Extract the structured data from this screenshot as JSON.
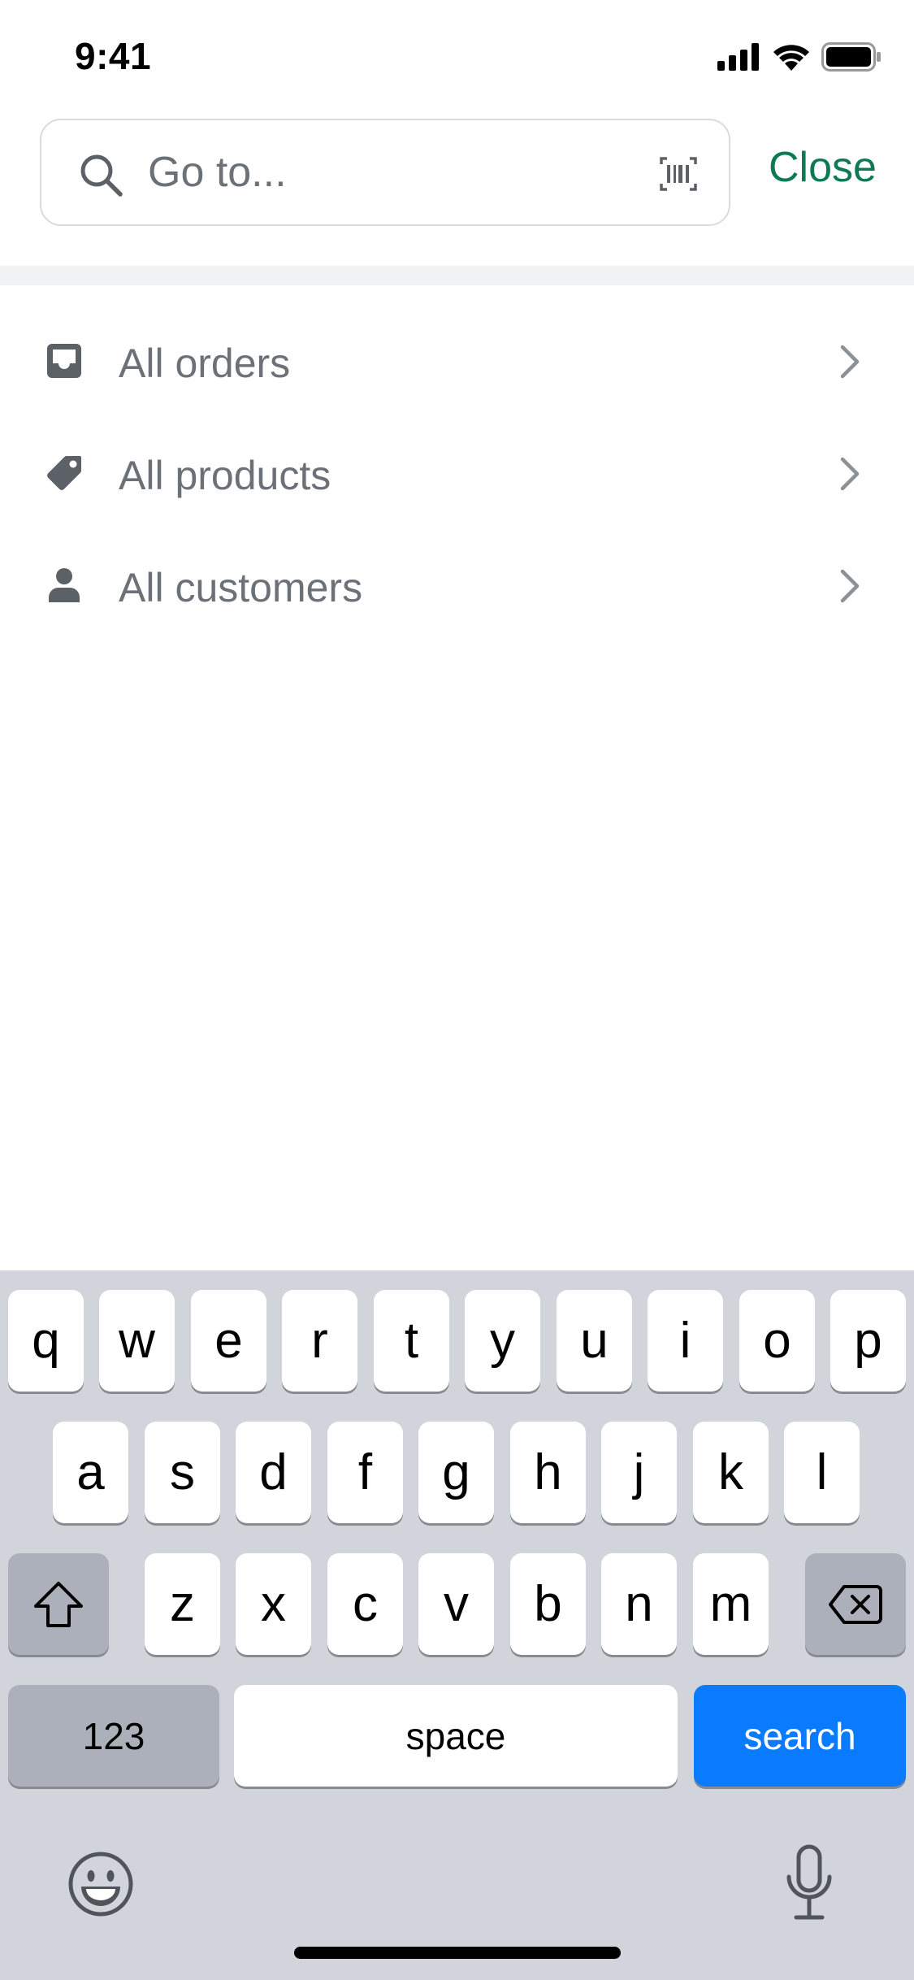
{
  "status_bar": {
    "time": "9:41"
  },
  "search": {
    "placeholder": "Go to...",
    "value": "",
    "close_label": "Close"
  },
  "nav": {
    "items": [
      {
        "label": "All orders",
        "icon": "inbox-icon"
      },
      {
        "label": "All products",
        "icon": "tag-icon"
      },
      {
        "label": "All customers",
        "icon": "person-icon"
      }
    ]
  },
  "keyboard": {
    "row1": [
      "q",
      "w",
      "e",
      "r",
      "t",
      "y",
      "u",
      "i",
      "o",
      "p"
    ],
    "row2": [
      "a",
      "s",
      "d",
      "f",
      "g",
      "h",
      "j",
      "k",
      "l"
    ],
    "row3": [
      "z",
      "x",
      "c",
      "v",
      "b",
      "n",
      "m"
    ],
    "numbers_label": "123",
    "space_label": "space",
    "search_label": "search"
  },
  "colors": {
    "accent_green": "#0e7a55",
    "keyboard_search_blue": "#0a7bff",
    "keyboard_bg": "#d1d4db",
    "label_gray": "#6b7177"
  }
}
